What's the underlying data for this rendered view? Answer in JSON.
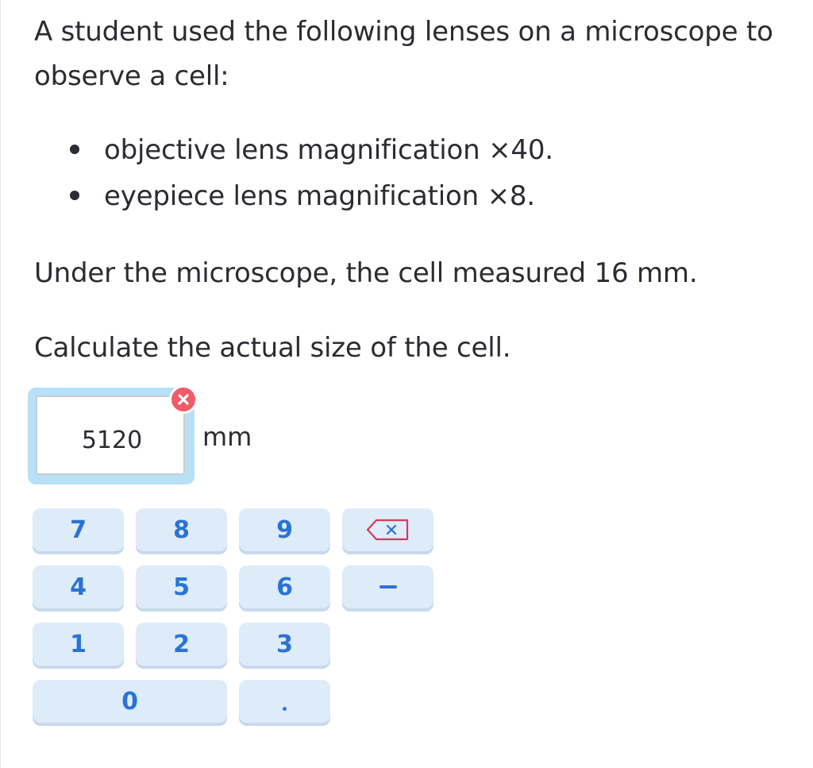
{
  "question": {
    "intro": "A student used the following lenses on a microscope to observe a cell:",
    "bullets": [
      "objective lens magnification ×40.",
      "eyepiece lens magnification ×8."
    ],
    "measurement": "Under the microscope, the cell measured 16 mm.",
    "task": "Calculate the actual size of the cell."
  },
  "answer": {
    "value": "5120",
    "unit": "mm",
    "status": "incorrect",
    "status_icon": "cross-icon",
    "status_color": "#f05b68"
  },
  "keypad": {
    "keys": {
      "seven": "7",
      "eight": "8",
      "nine": "9",
      "four": "4",
      "five": "5",
      "six": "6",
      "one": "1",
      "two": "2",
      "three": "3",
      "zero": "0"
    },
    "backspace_icon": "backspace-icon",
    "minus_icon": "minus-icon",
    "decimal_icon": "decimal-point-icon",
    "key_color": "#deebf8",
    "text_color": "#2a73d5",
    "backspace_color": "#d33b5a"
  }
}
